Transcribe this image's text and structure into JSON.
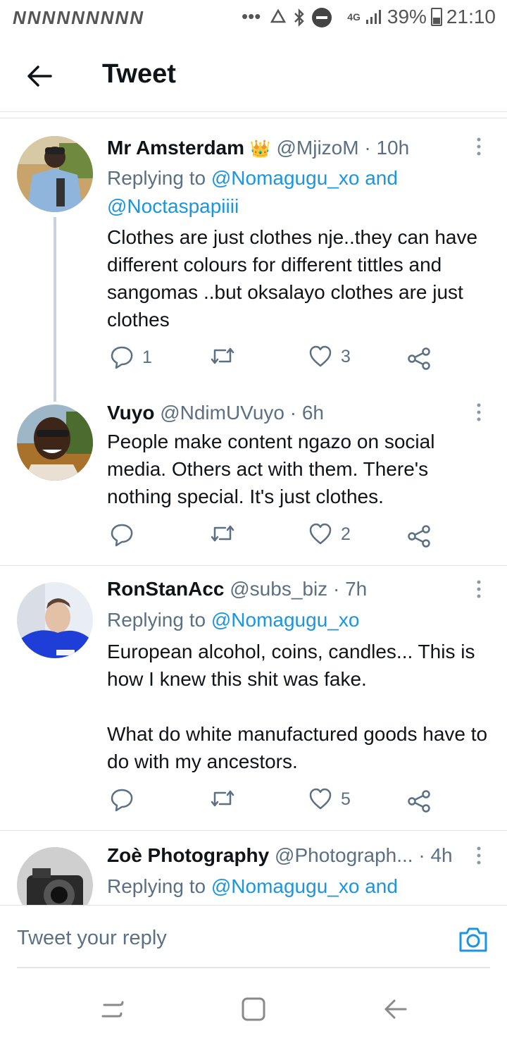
{
  "status_bar": {
    "left_text": "NNNNNNNNN",
    "overflow": "•••",
    "network": "4G",
    "battery": "39%",
    "time": "21:10"
  },
  "header": {
    "title": "Tweet"
  },
  "tweets": [
    {
      "name": "Mr Amsterdam",
      "emoji": "👑",
      "handle": "@MjizoM",
      "dot": "·",
      "time": "10h",
      "reply_prefix": "Replying to ",
      "reply_link1": "@Nomagugu_xo and",
      "reply_link2": "@Noctaspapiiii",
      "body": "Clothes are just clothes nje..they can have different colours for different tittles and sangomas ..but oksalayo clothes are just clothes",
      "replies": "1",
      "retweets": "",
      "likes": "3"
    },
    {
      "name": "Vuyo",
      "handle": "@NdimUVuyo",
      "dot": "·",
      "time": "6h",
      "body": "People make content ngazo on social media. Others act with them. There's nothing special. It's just clothes.",
      "replies": "",
      "retweets": "",
      "likes": "2"
    },
    {
      "name": "RonStanAcc",
      "handle": "@subs_biz",
      "dot": "·",
      "time": "7h",
      "reply_prefix": "Replying to ",
      "reply_link1": "@Nomagugu_xo",
      "body": "European alcohol, coins, candles... This is how I knew this shit was fake.\n\nWhat do white manufactured goods have to do with my ancestors.",
      "replies": "",
      "retweets": "",
      "likes": "5"
    },
    {
      "name": "Zoè Photography",
      "handle": "@Photograph...",
      "dot": "·",
      "time": "4h",
      "reply_prefix": "Replying to ",
      "reply_link1": "@Nomagugu_xo and"
    }
  ],
  "reply_bar": {
    "placeholder": "Tweet your reply"
  },
  "colors": {
    "link": "#1b95e0",
    "secondary_text": "#5b7083",
    "divider": "#e1e4e6"
  },
  "icons": {
    "reply": "speech-bubble-icon",
    "retweet": "retweet-icon",
    "like": "heart-icon",
    "share": "share-icon",
    "camera": "camera-icon"
  }
}
